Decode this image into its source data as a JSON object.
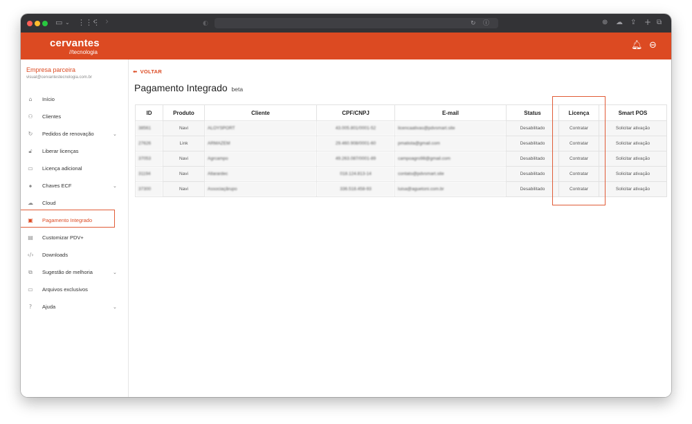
{
  "app": {
    "logo_main": "cervantes",
    "logo_sub": "//tecnologia"
  },
  "sidebar": {
    "company": "Empresa parceira",
    "email": "visual@cervantestecnologia.com.br",
    "items": [
      {
        "label": "Início",
        "icon": "home-icon",
        "chevron": false
      },
      {
        "label": "Clientes",
        "icon": "users-icon",
        "chevron": false
      },
      {
        "label": "Pedidos de renovação",
        "icon": "refresh-icon",
        "chevron": true
      },
      {
        "label": "Liberar licenças",
        "icon": "lock-icon",
        "chevron": false
      },
      {
        "label": "Licença adicional",
        "icon": "window-icon",
        "chevron": false
      },
      {
        "label": "Chaves ECF",
        "icon": "key-icon",
        "chevron": true
      },
      {
        "label": "Cloud",
        "icon": "cloud-icon",
        "chevron": false
      },
      {
        "label": "Pagamento Integrado",
        "icon": "card-icon",
        "chevron": false,
        "active": true
      },
      {
        "label": "Customizar PDV+",
        "icon": "grid-icon",
        "chevron": false
      },
      {
        "label": "Downloads",
        "icon": "code-icon",
        "chevron": false
      },
      {
        "label": "Sugestão de melhoria",
        "icon": "copy-icon",
        "chevron": true
      },
      {
        "label": "Arquivos exclusivos",
        "icon": "folder-icon",
        "chevron": false
      },
      {
        "label": "Ajuda",
        "icon": "help-icon",
        "chevron": true
      }
    ]
  },
  "main": {
    "back_label": "VOLTAR",
    "title": "Pagamento Integrado",
    "title_badge": "beta",
    "table": {
      "columns": [
        "ID",
        "Produto",
        "Cliente",
        "CPF/CNPJ",
        "E-mail",
        "Status",
        "Licença",
        "Smart POS"
      ],
      "rows": [
        {
          "id": "38561",
          "produto": "Navi",
          "cliente": "ALOYSPORT",
          "cpf": "43.005.801/0001-52",
          "email": "licencaativas@pdvsmart.site",
          "status": "Desabilitado",
          "licenca": "Contratar",
          "smartpos": "Solicitar ativação"
        },
        {
          "id": "27626",
          "produto": "Link",
          "cliente": "ARMAZEM",
          "cpf": "29.460.908/0001-60",
          "email": "pmatiola@gmail.com",
          "status": "Desabilitado",
          "licenca": "Contratar",
          "smartpos": "Solicitar ativação"
        },
        {
          "id": "37053",
          "produto": "Navi",
          "cliente": "Agrcampo",
          "cpf": "49.263.087/0001-89",
          "email": "campoagro98@gmail.com",
          "status": "Desabilitado",
          "licenca": "Contratar",
          "smartpos": "Solicitar ativação"
        },
        {
          "id": "31194",
          "produto": "Navi",
          "cliente": "Allarardec",
          "cpf": "018.124.813-14",
          "email": "contato@pdvsmart.site",
          "status": "Desabilitado",
          "licenca": "Contratar",
          "smartpos": "Solicitar ativação"
        },
        {
          "id": "37300",
          "produto": "Navi",
          "cliente": "Associaçãrupo",
          "cpf": "336.518.458-93",
          "email": "luisa@aguetoni.com.br",
          "status": "Desabilitado",
          "licenca": "Contratar",
          "smartpos": "Solicitar ativação"
        }
      ]
    }
  },
  "colors": {
    "brand": "#dc4a22",
    "status_disabled": "#e03a2a",
    "link": "#2d8fd5"
  }
}
